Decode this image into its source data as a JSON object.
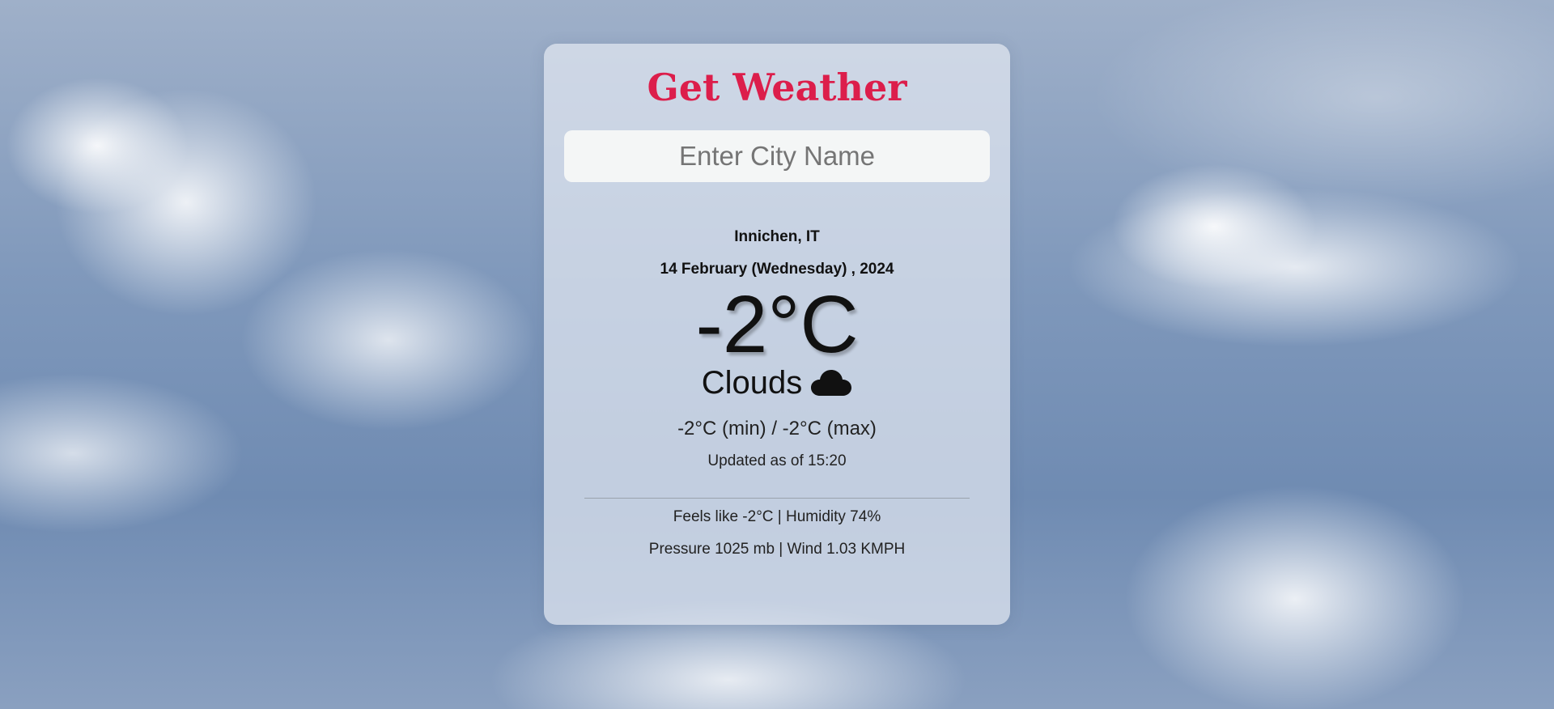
{
  "app": {
    "title": "Get Weather"
  },
  "search": {
    "placeholder": "Enter City Name",
    "value": ""
  },
  "weather": {
    "location": "Innichen, IT",
    "date": "14 February (Wednesday) , 2024",
    "temperature": "-2°C",
    "condition": "Clouds",
    "condition_icon": "cloud-icon",
    "min_max": "-2°C (min) / -2°C (max)",
    "updated": "Updated as of 15:20",
    "feels_humidity": "Feels like -2°C | Humidity 74%",
    "pressure_wind": "Pressure 1025 mb | Wind 1.03 KMPH"
  },
  "colors": {
    "title": "#dc1e4b",
    "card_bg": "#e2e8f1",
    "input_bg": "#f4f6f6",
    "text": "#111111"
  }
}
